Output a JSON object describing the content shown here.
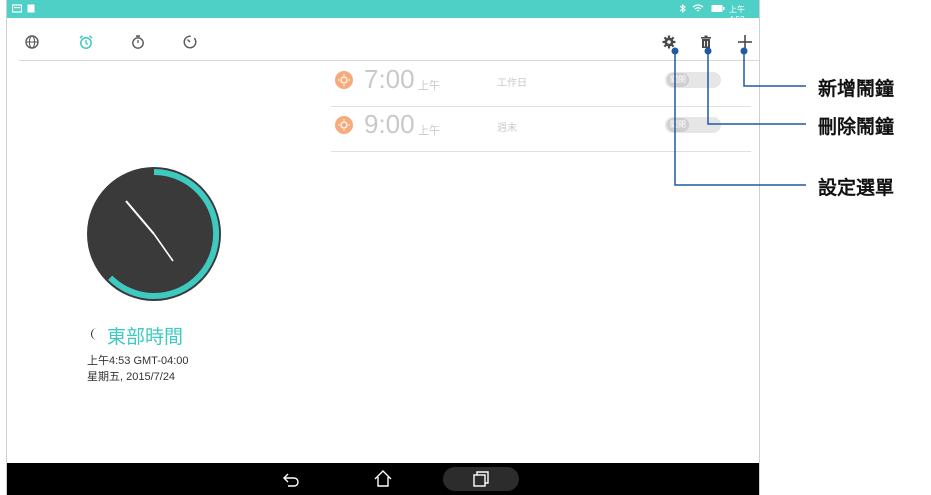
{
  "status_bar": {
    "time": "上午4:53",
    "accent_color": "#4fd0c6"
  },
  "toolbar": {
    "tabs": [
      {
        "name": "world-clock",
        "icon": "globe-icon"
      },
      {
        "name": "alarm",
        "icon": "alarm-clock-icon",
        "active": true
      },
      {
        "name": "stopwatch",
        "icon": "stopwatch-icon"
      },
      {
        "name": "timer",
        "icon": "timer-icon"
      }
    ],
    "actions": [
      "gear-icon",
      "trash-icon",
      "plus-icon"
    ]
  },
  "alarms": [
    {
      "time": "7:00",
      "ampm": "上午",
      "repeat": "工作日",
      "toggle_label": "關閉",
      "enabled": false
    },
    {
      "time": "9:00",
      "ampm": "上午",
      "repeat": "週末",
      "toggle_label": "關閉",
      "enabled": false
    }
  ],
  "clock": {
    "timezone_name": "東部時間",
    "time_line": "上午4:53   GMT-04:00",
    "date_line": "星期五, 2015/7/24",
    "accent_color": "#3ec9c1",
    "face_color": "#3a3a3a"
  },
  "callouts": {
    "add_alarm": "新增鬧鐘",
    "delete_alarm": "刪除鬧鐘",
    "settings_menu": "設定選單",
    "line_color": "#1f5aa0"
  }
}
